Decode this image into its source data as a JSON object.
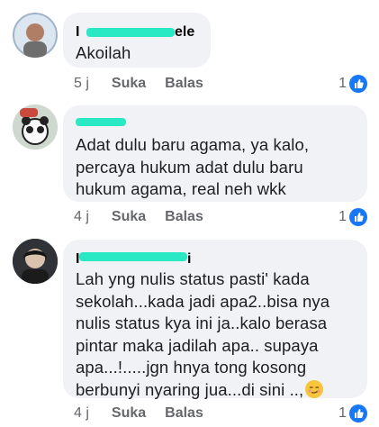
{
  "comments": [
    {
      "author_visible": "ele",
      "text": "Akoilah",
      "time": "5 j",
      "like_label": "Suka",
      "reply_label": "Balas",
      "like_count": "1"
    },
    {
      "author_visible": "",
      "text": "Adat dulu baru agama, ya kalo, percaya hukum adat dulu baru hukum agama, real neh wkk",
      "time": "4 j",
      "like_label": "Suka",
      "reply_label": "Balas",
      "like_count": "1"
    },
    {
      "author_visible": "i",
      "text": "Lah yng nulis status pasti' kada sekolah...kada jadi apa2..bisa nya nulis status kya ini ja..kalo berasa pintar maka jadilah apa.. supaya apa...!.....jgn hnya tong kosong berbunyi nyaring jua...di sini ..,",
      "time": "4 j",
      "like_label": "Suka",
      "reply_label": "Balas",
      "like_count": "1"
    }
  ],
  "colors": {
    "bubble": "#f0f2f5",
    "like_blue": "#1877f2",
    "redaction": "#29e8c4",
    "meta": "#65676b"
  },
  "icons": {
    "like": "thumbs-up-icon",
    "emoji": "smirking-face-emoji-icon"
  }
}
